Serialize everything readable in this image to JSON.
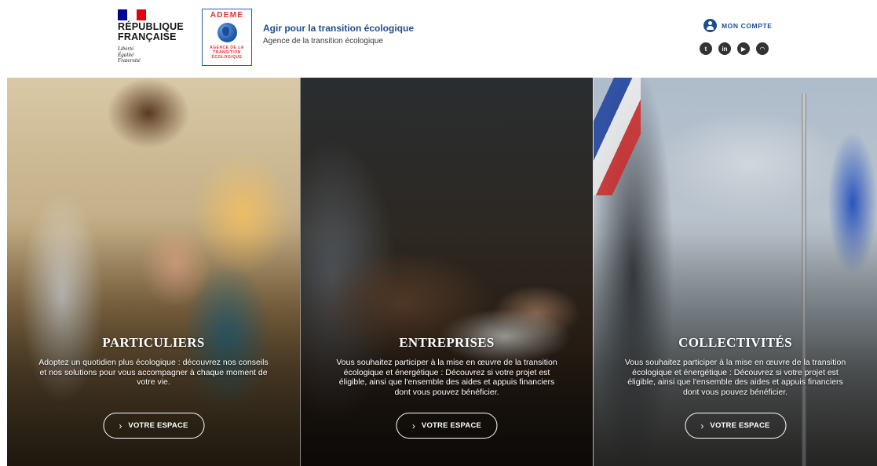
{
  "header": {
    "republique": {
      "name_line1": "RÉPUBLIQUE",
      "name_line2": "FRANÇAISE",
      "motto_line1": "Liberté",
      "motto_line2": "Égalité",
      "motto_line3": "Fraternité"
    },
    "ademe": {
      "wordmark": "ADEME",
      "subtitle_line1": "AGENCE DE LA",
      "subtitle_line2": "TRANSITION",
      "subtitle_line3": "ÉCOLOGIQUE"
    },
    "tagline": {
      "title": "Agir pour la transition écologique",
      "subtitle": "Agence de la transition écologique"
    },
    "account": {
      "label": "MON COMPTE",
      "icon": "user-circle-icon"
    },
    "socials": [
      {
        "name": "twitter",
        "glyph": "t"
      },
      {
        "name": "linkedin",
        "glyph": "in"
      },
      {
        "name": "youtube",
        "glyph": "▶"
      },
      {
        "name": "rss",
        "glyph": "◠"
      }
    ]
  },
  "panels": [
    {
      "title": "PARTICULIERS",
      "description": "Adoptez un quotidien plus écologique : découvrez nos conseils et nos solutions pour vous accompagner à chaque moment de votre vie.",
      "button": "VOTRE ESPACE"
    },
    {
      "title": "ENTREPRISES",
      "description": "Vous souhaitez participer à la mise en œuvre de la transition écologique et énergétique : Découvrez si votre projet est éligible, ainsi que l'ensemble des aides et appuis financiers dont vous pouvez bénéficier.",
      "button": "VOTRE ESPACE"
    },
    {
      "title": "COLLECTIVITÉS",
      "description": "Vous souhaitez participer à la mise en œuvre de la transition écologique et énergétique : Découvrez si votre projet est éligible, ainsi que l'ensemble des aides et appuis financiers dont vous pouvez bénéficier.",
      "button": "VOTRE ESPACE"
    }
  ],
  "colors": {
    "brand_blue": "#1f4e8c",
    "ademe_red": "#e0302d",
    "flag_blue": "#000091",
    "flag_red": "#e1000f"
  }
}
